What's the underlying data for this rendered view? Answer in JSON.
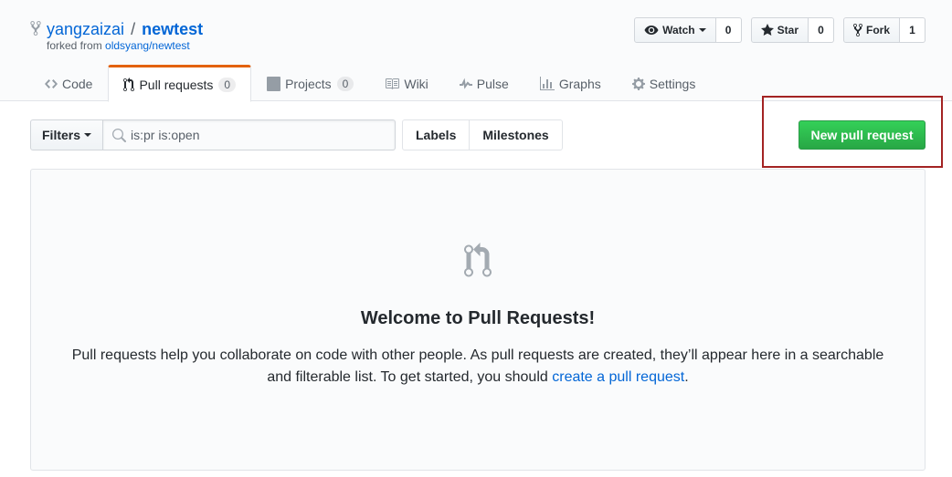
{
  "repo": {
    "owner": "yangzaizai",
    "separator": "/",
    "name": "newtest",
    "forked_prefix": "forked from",
    "forked_source": "oldsyang/newtest"
  },
  "actions": {
    "watch": {
      "label": "Watch",
      "count": "0"
    },
    "star": {
      "label": "Star",
      "count": "0"
    },
    "fork": {
      "label": "Fork",
      "count": "1"
    }
  },
  "tabs": [
    {
      "label": "Code",
      "icon": "code-icon"
    },
    {
      "label": "Pull requests",
      "icon": "pull-request-icon",
      "counter": "0",
      "selected": true
    },
    {
      "label": "Projects",
      "icon": "project-icon",
      "counter": "0"
    },
    {
      "label": "Wiki",
      "icon": "book-icon"
    },
    {
      "label": "Pulse",
      "icon": "pulse-icon"
    },
    {
      "label": "Graphs",
      "icon": "graph-icon"
    },
    {
      "label": "Settings",
      "icon": "gear-icon"
    }
  ],
  "subnav": {
    "filters_label": "Filters",
    "search_value": "is:pr is:open",
    "labels_label": "Labels",
    "milestones_label": "Milestones",
    "new_pr_label": "New pull request"
  },
  "blankslate": {
    "title": "Welcome to Pull Requests!",
    "text_before_link": "Pull requests help you collaborate on code with other people. As pull requests are created, they’ll appear here in a searchable and filterable list. To get started, you should",
    "link_text": "create a pull request",
    "text_after_link": "."
  },
  "colors": {
    "link": "#0366d6",
    "accent_tab": "#e36209",
    "primary_button": "#28a745",
    "annotation_box": "#a32323"
  }
}
